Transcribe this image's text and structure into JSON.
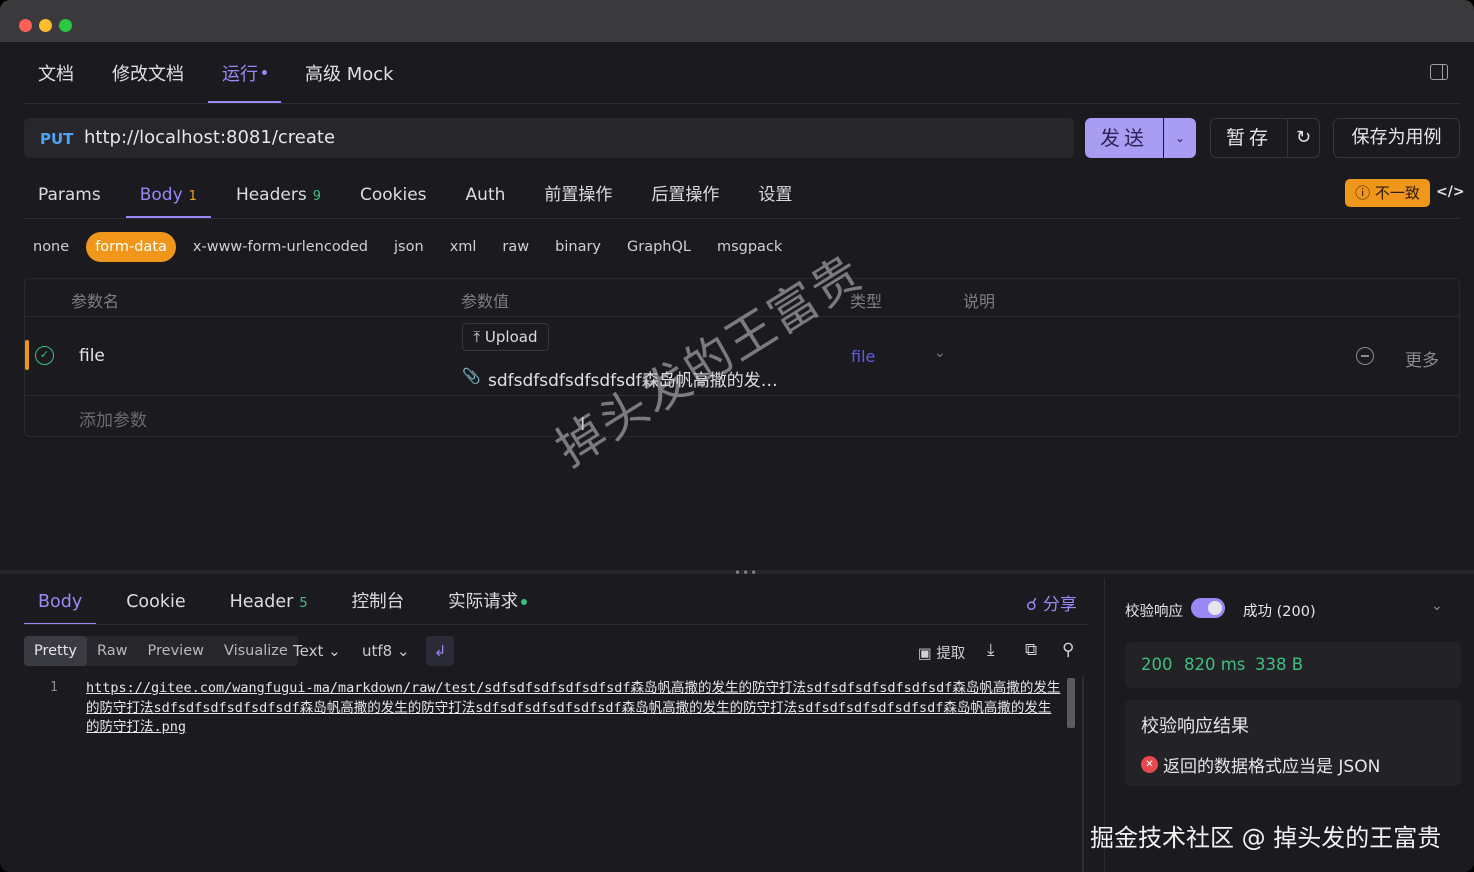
{
  "top_tabs": [
    {
      "label": "文档"
    },
    {
      "label": "修改文档"
    },
    {
      "label": "运行"
    },
    {
      "label": "高级 Mock"
    }
  ],
  "request": {
    "method": "PUT",
    "url": "http://localhost:8081/create",
    "send_label": "发送",
    "save_label": "暂存",
    "save_case_label": "保存为用例"
  },
  "request_tabs": [
    {
      "label": "Params"
    },
    {
      "label": "Body",
      "count": "1"
    },
    {
      "label": "Headers",
      "count": "9"
    },
    {
      "label": "Cookies"
    },
    {
      "label": "Auth"
    },
    {
      "label": "前置操作"
    },
    {
      "label": "后置操作"
    },
    {
      "label": "设置"
    }
  ],
  "mismatch_label": "不一致",
  "body_types": [
    "none",
    "form-data",
    "x-www-form-urlencoded",
    "json",
    "xml",
    "raw",
    "binary",
    "GraphQL",
    "msgpack"
  ],
  "param_table": {
    "headers": [
      "参数名",
      "参数值",
      "类型",
      "说明"
    ],
    "rows": [
      {
        "name": "file",
        "upload_label": "Upload",
        "file_name": "sdfsdfsdfsdfsdfsdf森岛帆高撒的发生...",
        "type": "file",
        "more_label": "更多"
      }
    ],
    "add_placeholder": "添加参数"
  },
  "watermark": "掉头发的王富贵",
  "response_tabs": [
    {
      "label": "Body"
    },
    {
      "label": "Cookie"
    },
    {
      "label": "Header",
      "count": "5"
    },
    {
      "label": "控制台"
    },
    {
      "label": "实际请求"
    }
  ],
  "share_label": "分享",
  "view_modes": [
    "Pretty",
    "Raw",
    "Preview",
    "Visualize"
  ],
  "format_select": "Text",
  "encoding_select": "utf8",
  "extract_label": "提取",
  "response_body": {
    "line_number": "1",
    "text": "https://gitee.com/wangfugui-ma/markdown/raw/test/sdfsdfsdfsdfsdfsdf森岛帆高撒的发生的防守打法sdfsdfsdfsdfsdfsdf森岛帆高撒的发生的防守打法sdfsdfsdfsdfsdfsdf森岛帆高撒的发生的防守打法sdfsdfsdfsdfsdfsdf森岛帆高撒的发生的防守打法sdfsdfsdfsdfsdfsdf森岛帆高撒的发生的防守打法.png"
  },
  "validation": {
    "label": "校验响应",
    "status": "成功 (200)",
    "code": "200",
    "time": "820 ms",
    "size": "338 B",
    "result_title": "校验响应结果",
    "error": "返回的数据格式应当是 JSON"
  },
  "footer_watermark": "掘金技术社区 @ 掉头发的王富贵",
  "colors": {
    "accent": "#9b87f5",
    "warning": "#f0961a",
    "success": "#3fbf7f",
    "error": "#e5484d"
  }
}
